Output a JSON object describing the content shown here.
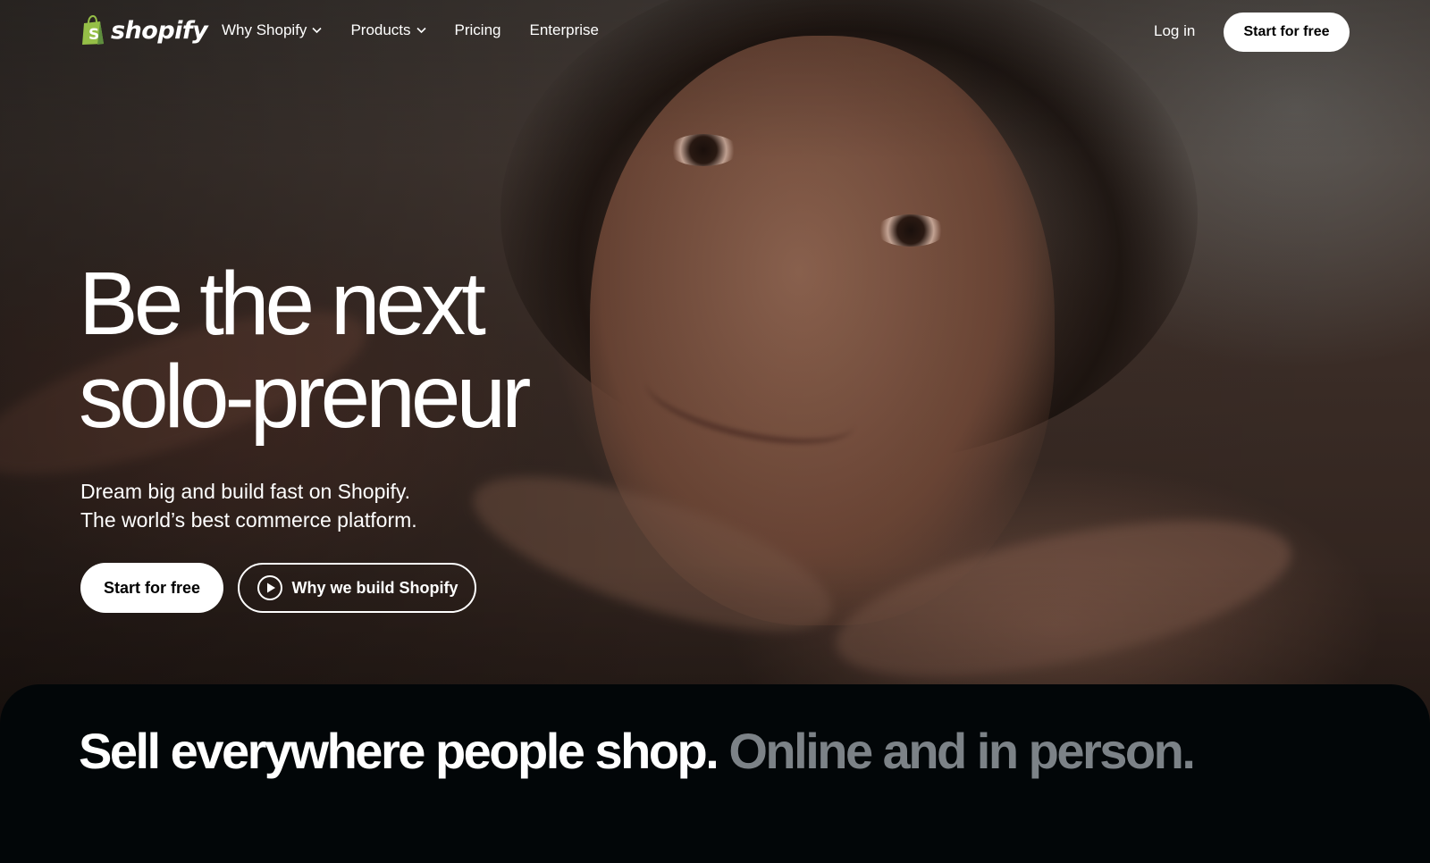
{
  "brand": {
    "name": "shopify",
    "logo_icon": "shopping-bag-icon",
    "colors": {
      "logo_green": "#95bf47",
      "logo_dark_green": "#5e8e3e",
      "cta_bg": "#ffffff",
      "muted_text": "#7c8287"
    }
  },
  "nav": {
    "links": [
      {
        "label": "Why Shopify",
        "has_dropdown": true
      },
      {
        "label": "Products",
        "has_dropdown": true
      },
      {
        "label": "Pricing",
        "has_dropdown": false
      },
      {
        "label": "Enterprise",
        "has_dropdown": false
      }
    ],
    "login_label": "Log in",
    "cta_label": "Start for free"
  },
  "hero": {
    "headline_line1": "Be the next",
    "headline_line2": "solo-preneur",
    "sub_line1": "Dream big and build fast on Shopify.",
    "sub_line2": "The world’s best commerce platform.",
    "primary_cta": "Start for free",
    "secondary_cta": "Why we build Shopify",
    "secondary_icon": "play-icon"
  },
  "section": {
    "title_main": "Sell everywhere people shop.",
    "title_muted": "Online and in person."
  }
}
